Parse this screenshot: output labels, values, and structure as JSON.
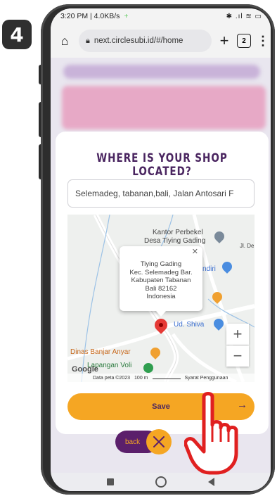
{
  "step_badge": "4",
  "status_bar": {
    "time_speed": "3:20 PM | 4.0KB/s",
    "plus_icon": "+",
    "signal_icons": "✱ .ıl ≋ ▭"
  },
  "browser": {
    "url": "next.circlesubi.id/#/home",
    "tab_count": "2"
  },
  "modal": {
    "title": "WHERE IS YOUR SHOP LOCATED?",
    "address_value": "Selemadeg, tabanan,bali, Jalan Antosari F"
  },
  "map": {
    "labels": {
      "kantor_line1": "Kantor Perbekel",
      "kantor_line2": "Desa Tiying Gading",
      "jl": "Jl. De",
      "ndiri": "ndiri",
      "ud_shiva": "Ud. Shiva",
      "dinas": "Dinas Banjar Anyar",
      "lapangan": "Lapangan Voli"
    },
    "info_window": {
      "line1": "Tiying Gading",
      "line2": "Kec. Selemadeg Bar.",
      "line3": "Kabupaten Tabanan",
      "line4": "Bali 82162",
      "line5": "Indonesia"
    },
    "footer": {
      "google": "Google",
      "data": "Data peta ©2023",
      "scale": "100 m",
      "terms": "Syarat Penggunaan"
    },
    "zoom_in": "+",
    "zoom_out": "−"
  },
  "save_button": {
    "label": "Save",
    "arrow": "→"
  },
  "back_button": {
    "label": "back"
  },
  "colors": {
    "brand_purple": "#5b1f6b",
    "accent_orange": "#f5a623",
    "title_purple": "#4a2560"
  }
}
